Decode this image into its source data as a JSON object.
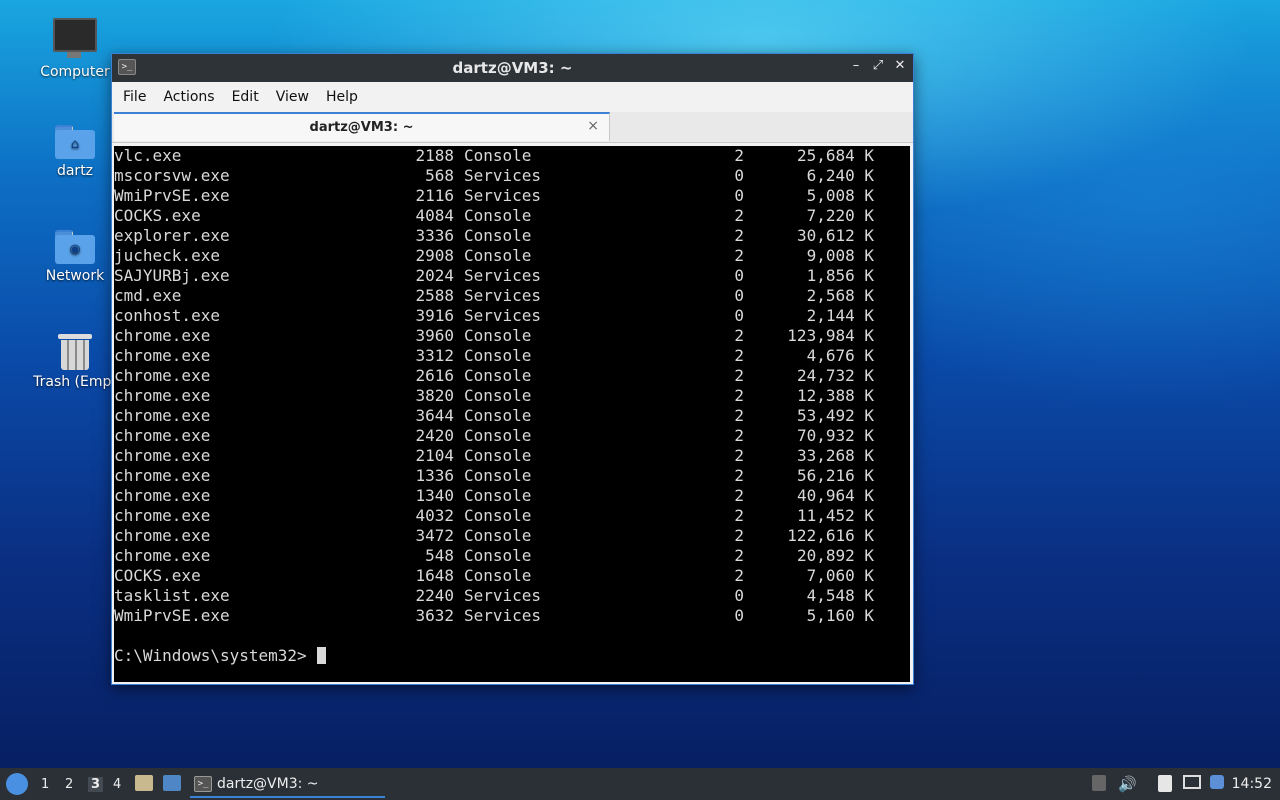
{
  "desktop": {
    "icons": [
      {
        "label": "Computer"
      },
      {
        "label": "dartz"
      },
      {
        "label": "Network"
      },
      {
        "label": "Trash (Empt"
      }
    ]
  },
  "window": {
    "title": "dartz@VM3: ~",
    "controls": {
      "minimize": "–",
      "maximize": "⤢",
      "close": "✕"
    },
    "menu": [
      "File",
      "Actions",
      "Edit",
      "View",
      "Help"
    ],
    "tab": {
      "label": "dartz@VM3: ~",
      "close": "×"
    }
  },
  "terminal": {
    "rows": [
      {
        "name": "vlc.exe",
        "pid": "2188",
        "session": "Console",
        "num": "2",
        "mem": "25,684 K"
      },
      {
        "name": "mscorsvw.exe",
        "pid": "568",
        "session": "Services",
        "num": "0",
        "mem": "6,240 K"
      },
      {
        "name": "WmiPrvSE.exe",
        "pid": "2116",
        "session": "Services",
        "num": "0",
        "mem": "5,008 K"
      },
      {
        "name": "COCKS.exe",
        "pid": "4084",
        "session": "Console",
        "num": "2",
        "mem": "7,220 K"
      },
      {
        "name": "explorer.exe",
        "pid": "3336",
        "session": "Console",
        "num": "2",
        "mem": "30,612 K"
      },
      {
        "name": "jucheck.exe",
        "pid": "2908",
        "session": "Console",
        "num": "2",
        "mem": "9,008 K"
      },
      {
        "name": "SAJYURBj.exe",
        "pid": "2024",
        "session": "Services",
        "num": "0",
        "mem": "1,856 K"
      },
      {
        "name": "cmd.exe",
        "pid": "2588",
        "session": "Services",
        "num": "0",
        "mem": "2,568 K"
      },
      {
        "name": "conhost.exe",
        "pid": "3916",
        "session": "Services",
        "num": "0",
        "mem": "2,144 K"
      },
      {
        "name": "chrome.exe",
        "pid": "3960",
        "session": "Console",
        "num": "2",
        "mem": "123,984 K"
      },
      {
        "name": "chrome.exe",
        "pid": "3312",
        "session": "Console",
        "num": "2",
        "mem": "4,676 K"
      },
      {
        "name": "chrome.exe",
        "pid": "2616",
        "session": "Console",
        "num": "2",
        "mem": "24,732 K"
      },
      {
        "name": "chrome.exe",
        "pid": "3820",
        "session": "Console",
        "num": "2",
        "mem": "12,388 K"
      },
      {
        "name": "chrome.exe",
        "pid": "3644",
        "session": "Console",
        "num": "2",
        "mem": "53,492 K"
      },
      {
        "name": "chrome.exe",
        "pid": "2420",
        "session": "Console",
        "num": "2",
        "mem": "70,932 K"
      },
      {
        "name": "chrome.exe",
        "pid": "2104",
        "session": "Console",
        "num": "2",
        "mem": "33,268 K"
      },
      {
        "name": "chrome.exe",
        "pid": "1336",
        "session": "Console",
        "num": "2",
        "mem": "56,216 K"
      },
      {
        "name": "chrome.exe",
        "pid": "1340",
        "session": "Console",
        "num": "2",
        "mem": "40,964 K"
      },
      {
        "name": "chrome.exe",
        "pid": "4032",
        "session": "Console",
        "num": "2",
        "mem": "11,452 K"
      },
      {
        "name": "chrome.exe",
        "pid": "3472",
        "session": "Console",
        "num": "2",
        "mem": "122,616 K"
      },
      {
        "name": "chrome.exe",
        "pid": "548",
        "session": "Console",
        "num": "2",
        "mem": "20,892 K"
      },
      {
        "name": "COCKS.exe",
        "pid": "1648",
        "session": "Console",
        "num": "2",
        "mem": "7,060 K"
      },
      {
        "name": "tasklist.exe",
        "pid": "2240",
        "session": "Services",
        "num": "0",
        "mem": "4,548 K"
      },
      {
        "name": "WmiPrvSE.exe",
        "pid": "3632",
        "session": "Services",
        "num": "0",
        "mem": "5,160 K"
      }
    ],
    "prompt": "C:\\Windows\\system32>"
  },
  "taskbar": {
    "workspaces": [
      "1",
      "2",
      "3",
      "4"
    ],
    "active_workspace": "3",
    "task_label": "dartz@VM3: ~",
    "clock": "14:52"
  }
}
